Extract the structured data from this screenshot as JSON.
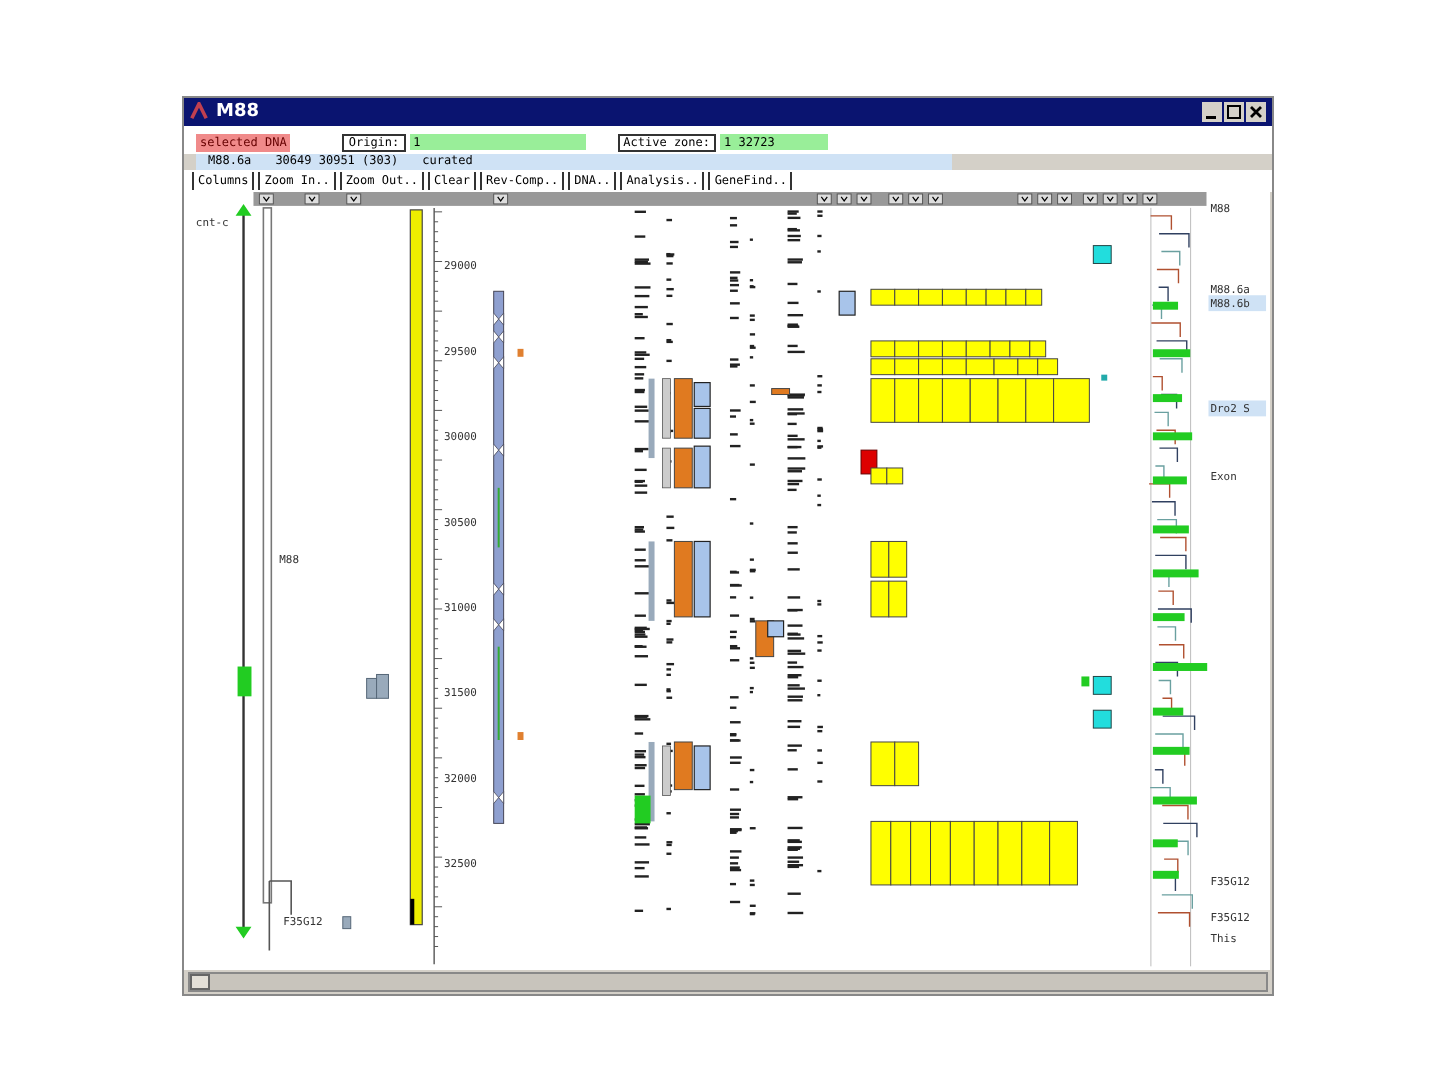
{
  "window": {
    "title": "M88"
  },
  "toolbar": {
    "selection": "selected DNA",
    "origin": {
      "label": "Origin:",
      "value": "1"
    },
    "active_zone": {
      "label": "Active zone:",
      "value": "1 32723"
    }
  },
  "info": {
    "name": "M88.6a",
    "coords": "30649 30951 (303)",
    "status": "curated"
  },
  "buttons": [
    "Columns",
    "Zoom In..",
    "Zoom Out..",
    "Clear",
    "Rev-Comp..",
    "DNA..",
    "Analysis..",
    "GeneFind.."
  ],
  "map": {
    "left_labels": [
      {
        "text": "cnt-c"
      },
      {
        "text": "M88"
      },
      {
        "text": "F35G12"
      }
    ],
    "ruler": [
      "29000",
      "29500",
      "30000",
      "30500",
      "31000",
      "31500",
      "32000",
      "32500"
    ],
    "right_labels": [
      {
        "text": "M88",
        "highlighted": false
      },
      {
        "text": "M88.6a",
        "highlighted": false
      },
      {
        "text": "M88.6b",
        "highlighted": true
      },
      {
        "text": "Dro2 S",
        "highlighted": true
      },
      {
        "text": "Exon",
        "highlighted": false
      },
      {
        "text": "F35G12",
        "highlighted": false
      },
      {
        "text": "F35G12",
        "highlighted": false
      },
      {
        "text": "This",
        "highlighted": false
      }
    ]
  }
}
